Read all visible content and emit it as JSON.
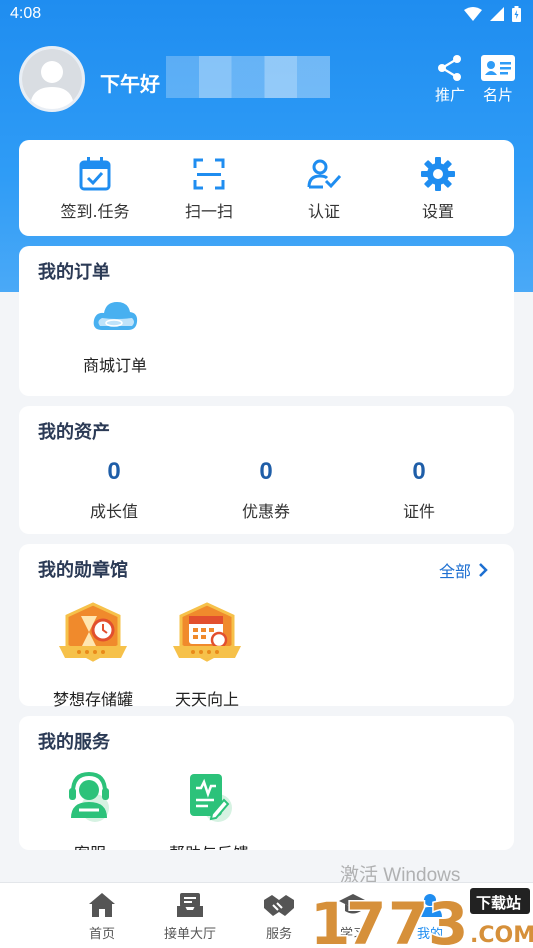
{
  "status_bar": {
    "time": "4:08"
  },
  "profile": {
    "greeting": "下午好",
    "actions": [
      {
        "label": "推广",
        "icon": "share-icon"
      },
      {
        "label": "名片",
        "icon": "id-card-icon"
      }
    ]
  },
  "quick_actions": [
    {
      "label": "签到.任务",
      "icon": "calendar-check-icon"
    },
    {
      "label": "扫一扫",
      "icon": "scan-icon"
    },
    {
      "label": "认证",
      "icon": "user-verify-icon"
    },
    {
      "label": "设置",
      "icon": "gear-icon"
    }
  ],
  "orders": {
    "title": "我的订单",
    "items": [
      {
        "label": "商城订单",
        "icon": "cloud-icon"
      }
    ]
  },
  "assets": {
    "title": "我的资产",
    "items": [
      {
        "value": "0",
        "label": "成长值"
      },
      {
        "value": "0",
        "label": "优惠券"
      },
      {
        "value": "0",
        "label": "证件"
      }
    ]
  },
  "badges": {
    "title": "我的勋章馆",
    "see_all": "全部",
    "items": [
      {
        "label": "梦想存储罐",
        "icon": "hourglass-badge-icon"
      },
      {
        "label": "天天向上",
        "icon": "calendar-badge-icon"
      }
    ]
  },
  "services": {
    "title": "我的服务",
    "items": [
      {
        "label": "客服",
        "icon": "headset-icon"
      },
      {
        "label": "帮助与反馈",
        "icon": "feedback-icon"
      }
    ]
  },
  "tabbar": [
    {
      "label": "首页",
      "icon": "home-icon"
    },
    {
      "label": "接单大厅",
      "icon": "inbox-icon"
    },
    {
      "label": "服务",
      "icon": "handshake-icon"
    },
    {
      "label": "学习",
      "icon": "graduation-cap-icon"
    },
    {
      "label": "我的",
      "icon": "person-icon"
    }
  ],
  "overlay": {
    "windows_watermark": "激活 Windows",
    "site_logo": "1173.com",
    "download_tag": "下载站"
  },
  "colors": {
    "primary": "#1f8df0",
    "accent_text": "#1d6fd1",
    "value_text": "#1f5ea8",
    "title_text": "#2b3a55"
  }
}
